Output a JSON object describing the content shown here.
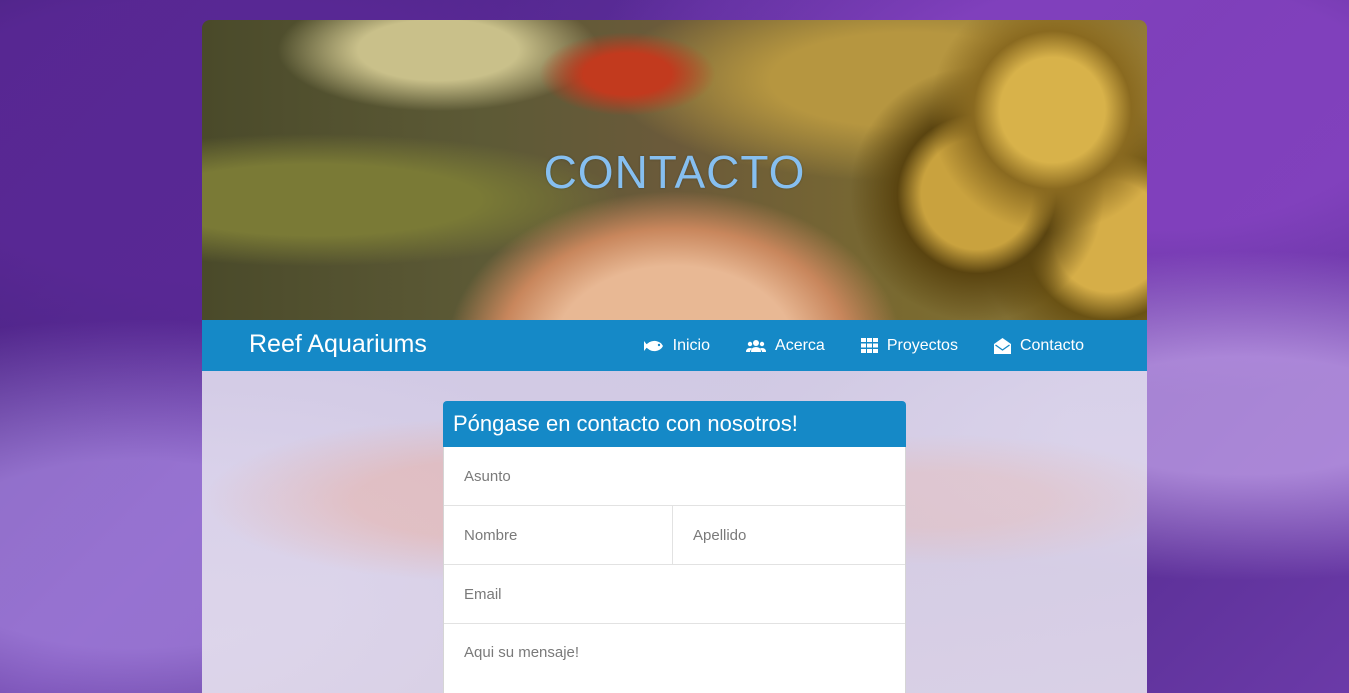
{
  "hero": {
    "title": "CONTACTO"
  },
  "navbar": {
    "brand": "Reef Aquariums",
    "items": [
      {
        "label": "Inicio",
        "icon": "fish-icon"
      },
      {
        "label": "Acerca",
        "icon": "users-icon"
      },
      {
        "label": "Proyectos",
        "icon": "grid-icon"
      },
      {
        "label": "Contacto",
        "icon": "envelope-open-icon"
      }
    ],
    "accent": "#1589c7"
  },
  "contact_form": {
    "heading": "Póngase en contacto con nosotros!",
    "subject_placeholder": "Asunto",
    "first_name_placeholder": "Nombre",
    "last_name_placeholder": "Apellido",
    "email_placeholder": "Email",
    "message_placeholder": "Aqui su mensaje!"
  }
}
